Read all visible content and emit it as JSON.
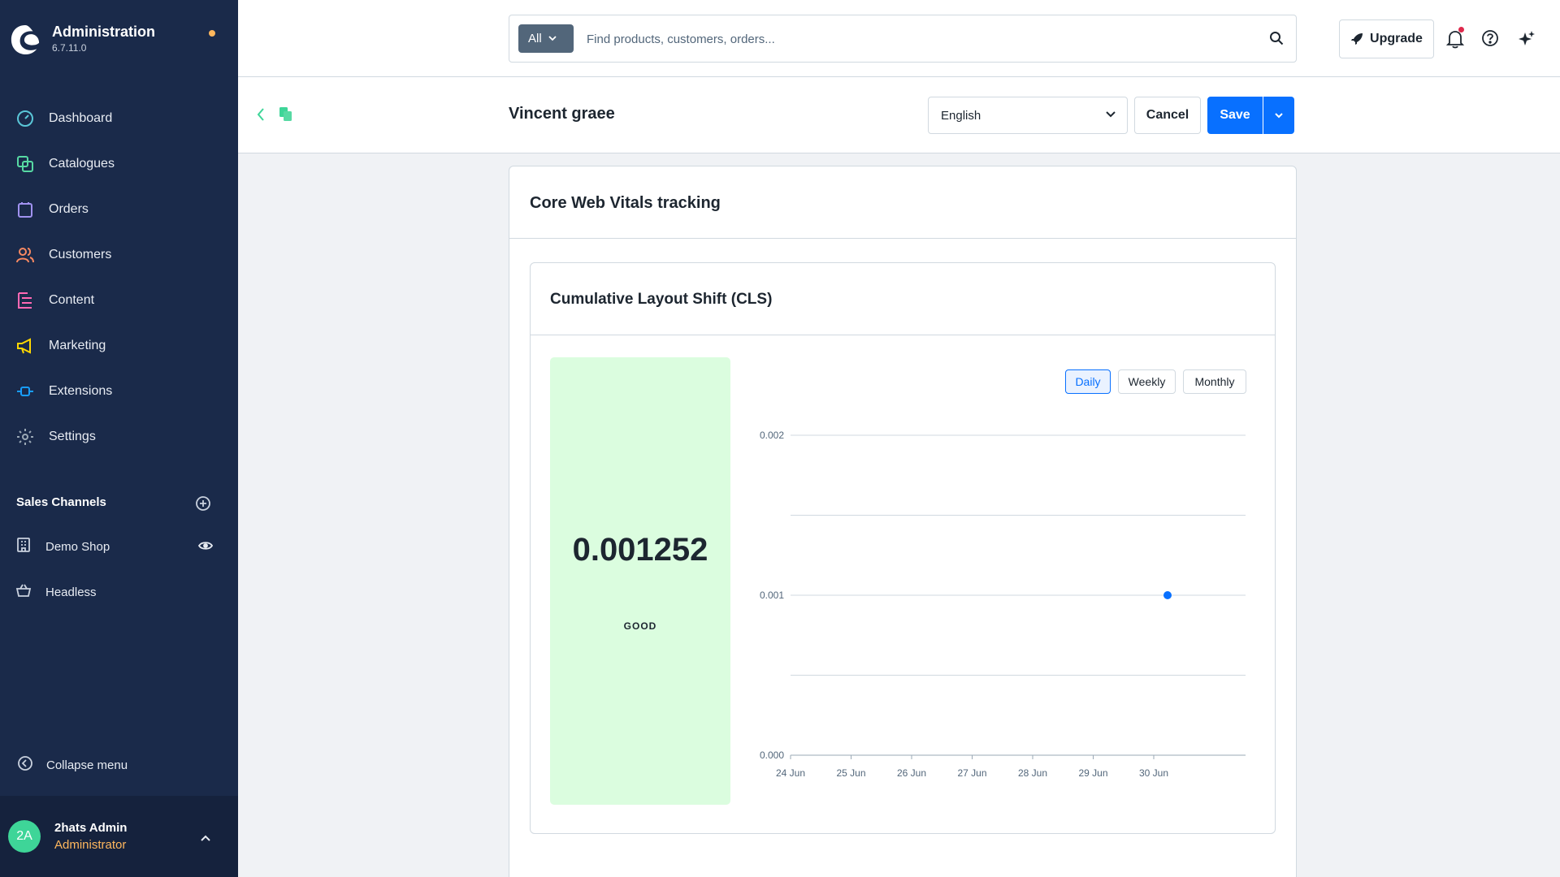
{
  "app": {
    "title": "Administration",
    "version": "6.7.11.0"
  },
  "nav": [
    {
      "label": "Dashboard",
      "icon": "gauge-icon",
      "color": "#5ac7d8"
    },
    {
      "label": "Catalogues",
      "icon": "catalogue-icon",
      "color": "#57d9a3"
    },
    {
      "label": "Orders",
      "icon": "shopping-bag-icon",
      "color": "#a092f0"
    },
    {
      "label": "Customers",
      "icon": "users-icon",
      "color": "#f88962"
    },
    {
      "label": "Content",
      "icon": "content-icon",
      "color": "#ff68b4"
    },
    {
      "label": "Marketing",
      "icon": "megaphone-icon",
      "color": "#ffd700"
    },
    {
      "label": "Extensions",
      "icon": "plug-icon",
      "color": "#189eff"
    },
    {
      "label": "Settings",
      "icon": "gear-icon",
      "color": "#9aa8b5"
    }
  ],
  "sales_channels": {
    "title": "Sales Channels",
    "items": [
      {
        "label": "Demo Shop",
        "icon": "storefront-icon"
      },
      {
        "label": "Headless",
        "icon": "basket-icon"
      }
    ]
  },
  "collapse_label": "Collapse menu",
  "user": {
    "initials": "2A",
    "name": "2hats Admin",
    "role": "Administrator"
  },
  "search": {
    "type_label": "All",
    "placeholder": "Find products, customers, orders..."
  },
  "topbar": {
    "upgrade_label": "Upgrade"
  },
  "smartbar": {
    "title": "Vincent graee",
    "language": "English",
    "cancel_label": "Cancel",
    "save_label": "Save"
  },
  "card": {
    "title": "Core Web Vitals tracking",
    "metric_title": "Cumulative Layout Shift (CLS)",
    "metric_value": "0.001252",
    "metric_status": "GOOD",
    "periods": [
      "Daily",
      "Weekly",
      "Monthly"
    ],
    "active_period": "Daily"
  },
  "colors": {
    "sidebar": "#1a2a4a",
    "accent": "#0870ff",
    "good": "#dbfddf",
    "brand_dot": "#ffb75d",
    "avatar": "#3ed598"
  },
  "chart_data": {
    "type": "line",
    "categories": [
      "24 Jun",
      "25 Jun",
      "26 Jun",
      "27 Jun",
      "28 Jun",
      "29 Jun",
      "30 Jun"
    ],
    "series": [
      {
        "values": [
          null,
          null,
          null,
          null,
          null,
          null,
          0.001
        ]
      }
    ],
    "yticks": [
      "0.000",
      "0.001",
      "0.002"
    ],
    "ylim": [
      0,
      0.002
    ],
    "grid": true
  }
}
